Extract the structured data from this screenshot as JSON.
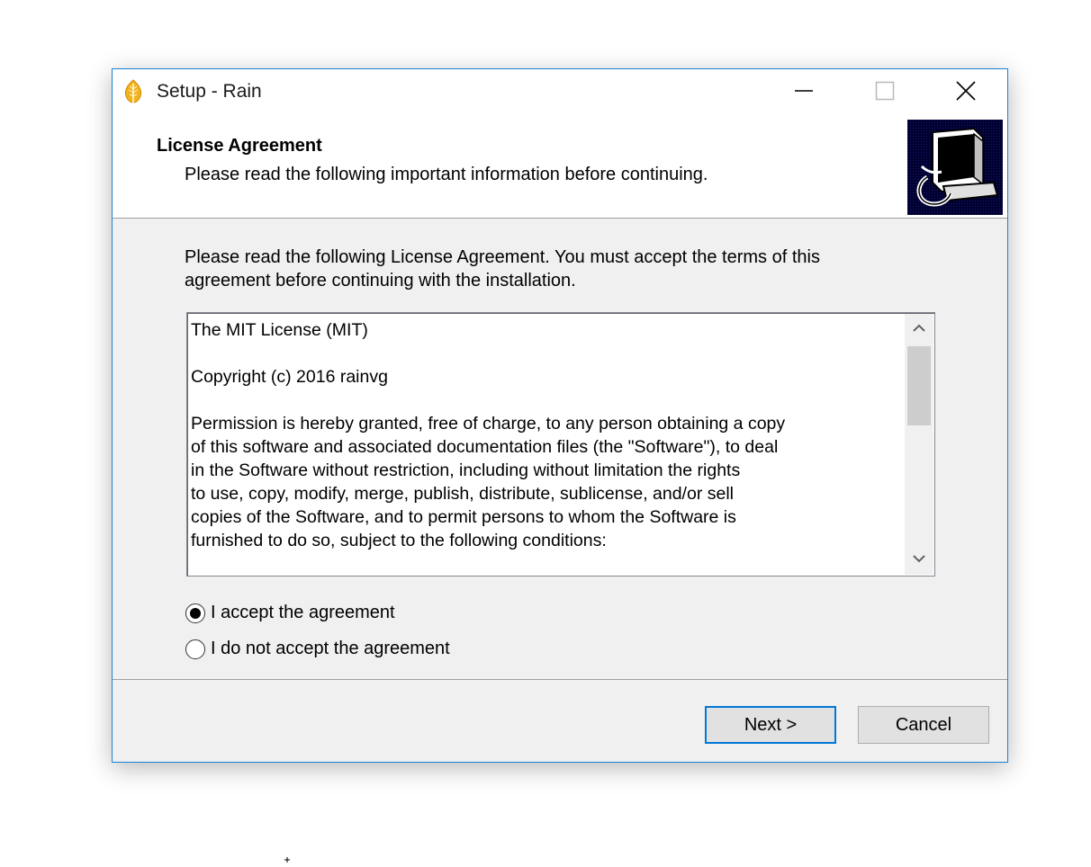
{
  "window": {
    "title": "Setup - Rain",
    "app_icon": "leaf-icon",
    "controls": {
      "minimize": "minimize-icon",
      "maximize": "maximize-icon",
      "close": "close-icon"
    }
  },
  "header": {
    "title": "License Agreement",
    "subtitle": "Please read the following important information before continuing.",
    "image": "computer-install-icon"
  },
  "body": {
    "intro": "Please read the following License Agreement. You must accept the terms of this agreement before continuing with the installation.",
    "license_text": "The MIT License (MIT)\n\nCopyright (c) 2016 rainvg\n\nPermission is hereby granted, free of charge, to any person obtaining a copy\nof this software and associated documentation files (the \"Software\"), to deal\nin the Software without restriction, including without limitation the rights\nto use, copy, modify, merge, publish, distribute, sublicense, and/or sell\ncopies of the Software, and to permit persons to whom the Software is\nfurnished to do so, subject to the following conditions:"
  },
  "options": [
    {
      "label": "I accept the agreement",
      "selected": true
    },
    {
      "label": "I do not accept the agreement",
      "selected": false
    }
  ],
  "buttons": {
    "next": "Next >",
    "cancel": "Cancel"
  },
  "colors": {
    "accent": "#0078d7",
    "window_border": "#1883d7",
    "header_image_bg": "#000040"
  }
}
